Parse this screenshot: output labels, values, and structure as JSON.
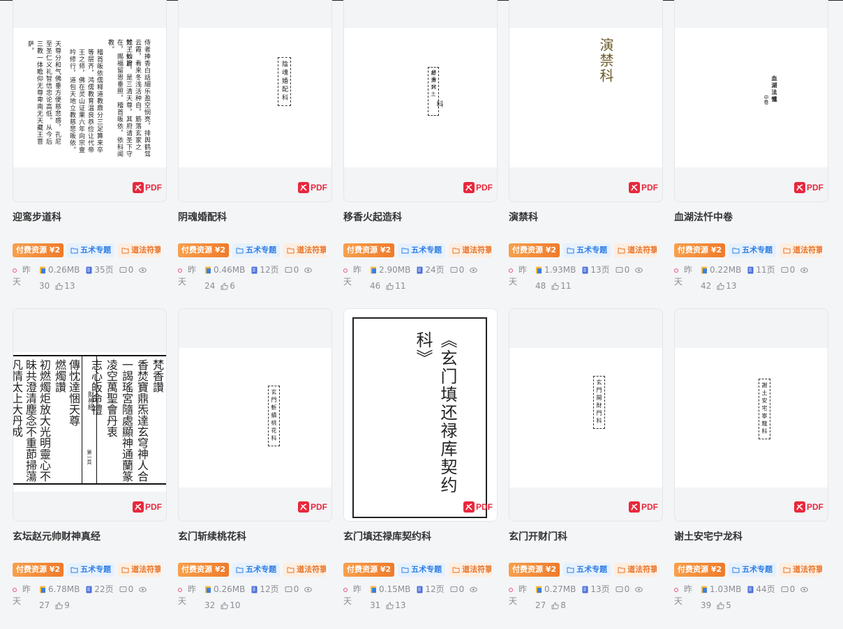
{
  "cards_row1": [
    {
      "title": "迎鸾步道科",
      "size": "0.26MB",
      "pages": "35页",
      "comments": "0",
      "views": "30",
      "likes": "13"
    },
    {
      "title": "阴魂婚配科",
      "size": "0.46MB",
      "pages": "12页",
      "comments": "0",
      "views": "24",
      "likes": "6"
    },
    {
      "title": "移香火起造科",
      "size": "2.90MB",
      "pages": "24页",
      "comments": "0",
      "views": "46",
      "likes": "11"
    },
    {
      "title": "演禁科",
      "size": "1.93MB",
      "pages": "13页",
      "comments": "0",
      "views": "48",
      "likes": "11"
    },
    {
      "title": "血湖法忏中卷",
      "size": "0.22MB",
      "pages": "11页",
      "comments": "0",
      "views": "42",
      "likes": "13"
    }
  ],
  "cards_row2": [
    {
      "title": "玄坛赵元帅财神真经",
      "size": "6.78MB",
      "pages": "22页",
      "comments": "0",
      "views": "27",
      "likes": "9"
    },
    {
      "title": "玄门斩续桃花科",
      "size": "0.26MB",
      "pages": "12页",
      "comments": "0",
      "views": "32",
      "likes": "10"
    },
    {
      "title": "玄门填还禄库契约科",
      "size": "0.15MB",
      "pages": "12页",
      "comments": "0",
      "views": "31",
      "likes": "13"
    },
    {
      "title": "玄门开财门科",
      "size": "0.27MB",
      "pages": "13页",
      "comments": "0",
      "views": "27",
      "likes": "8"
    },
    {
      "title": "谢土安宅宁龙科",
      "size": "1.03MB",
      "pages": "44页",
      "comments": "0",
      "views": "39",
      "likes": "5"
    }
  ],
  "tags": {
    "paid": "付费资源 ¥2",
    "topic": "五术专题",
    "category": "道法符箓"
  },
  "time_a": "昨",
  "time_b": "天",
  "pdf_label": "PDF",
  "covers": {
    "c1_col1": "侍者捧香白話細乐盈空悯亮，排舆鹤驾云霞，看来冬浅活种自，筋落玄家之妙，仙府",
    "c1_col2": "梵王妙旨，是三清天尊，其府请圣下守在，赐福留恩垂照，稽首皈依，依科闻教。",
    "c1_col3": "稽首皈依儒释道教鼎分三足算来卒等层齐，鸿儒教育温良恭俭让代帝王之师，佛在灵山证果六年向宗壹吟修行，道包天地立教慈悲皈依。",
    "c1_col4": "天尊分和气佛垂方便慈悲感，孔尼至圣仁义礼智信忠论高低。从今后三教一体瞻仰无尊卑南无天藏王菩萨。",
    "c2": "陰魂婚配科",
    "c3a": "移香火",
    "c3b": "起造封土",
    "c3c": "科",
    "c4": "演禁科",
    "c5": "血湖法懺",
    "c5b": "中卷",
    "c6a": "梵香讚",
    "c6b": "香焚寶鼎炁達玄穹神人合",
    "c6c": "一謁瑤宮隨處顯神通蘭篆",
    "c6d": "凌空萬聖會丹衷",
    "c6e": "志心皈命禮",
    "c6f": "傳忱達悃天尊",
    "c6g": "燃燭讚",
    "c6h": "初燃燭炬放大光明靈心不",
    "c6i": "昧共澄清塵念不重莭掃蕩",
    "c6j": "凡情太上大丹成",
    "c6k": "財神經",
    "c6l": "第一頁",
    "c7": "玄門斬續桃花科",
    "c8": "《玄门填还禄库契约科》",
    "c9": "玄門開財門科",
    "c10": "謝土安宅寧龍科"
  }
}
